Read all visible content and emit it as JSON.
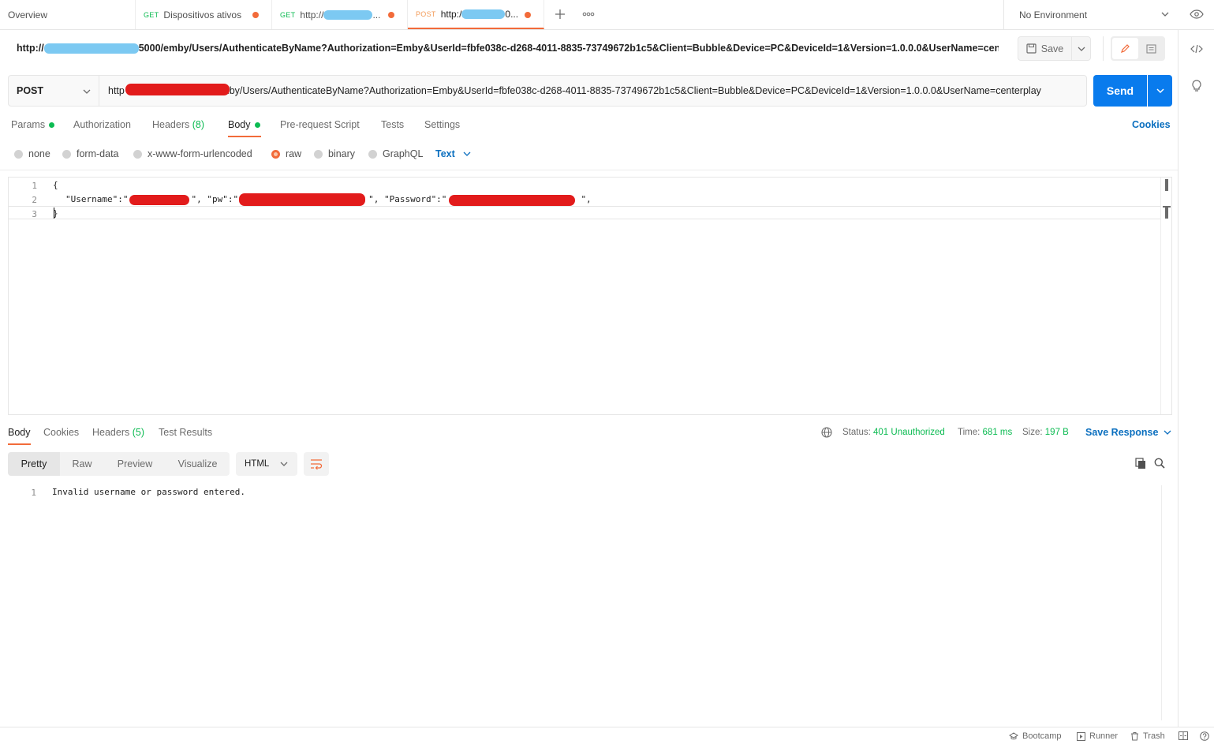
{
  "tabs": [
    {
      "label": "Overview"
    },
    {
      "method": "GET",
      "label": "Dispositivos ativos"
    },
    {
      "method": "GET",
      "label": "http://"
    },
    {
      "method": "POST",
      "label": "http:/",
      "suffix": "0..."
    }
  ],
  "environment": {
    "label": "No Environment"
  },
  "header": {
    "url_prefix": "http://",
    "url_rest": "5000/emby/Users/AuthenticateByName?Authorization=Emby&UserId=fbfe038c-d268-4011-8835-73749672b1c5&Client=Bubble&Device=PC&DeviceId=1&Version=1.0.0.0&UserName=cent...",
    "save_label": "Save"
  },
  "request": {
    "method": "POST",
    "url_prefix": "http",
    "url_rest": "/emby/Users/AuthenticateByName?Authorization=Emby&UserId=fbfe038c-d268-4011-8835-73749672b1c5&Client=Bubble&Device=PC&DeviceId=1&Version=1.0.0.0&UserName=centerplay",
    "send_label": "Send"
  },
  "request_tabs": {
    "params": "Params",
    "authorization": "Authorization",
    "headers": "Headers",
    "headers_count": "(8)",
    "body": "Body",
    "prerequest": "Pre-request Script",
    "tests": "Tests",
    "settings": "Settings",
    "cookies": "Cookies"
  },
  "body_types": {
    "none": "none",
    "form_data": "form-data",
    "urlencoded": "x-www-form-urlencoded",
    "raw": "raw",
    "binary": "binary",
    "graphql": "GraphQL",
    "text": "Text"
  },
  "editor": {
    "line_numbers": [
      "1",
      "2",
      "3"
    ],
    "line1": "{",
    "line3": "}",
    "username_key": "\"Username\":\"",
    "pw_key": "\", \"pw\":\"",
    "password_key": "\", \"Password\":\"",
    "line_end": "\","
  },
  "response_tabs": {
    "body": "Body",
    "cookies": "Cookies",
    "headers": "Headers",
    "headers_count": "(5)",
    "test_results": "Test Results"
  },
  "response_status": {
    "status_label": "Status:",
    "status_value": "401 Unauthorized",
    "time_label": "Time:",
    "time_value": "681 ms",
    "size_label": "Size:",
    "size_value": "197 B",
    "save_response": "Save Response"
  },
  "response_view": {
    "pretty": "Pretty",
    "raw": "Raw",
    "preview": "Preview",
    "visualize": "Visualize",
    "format": "HTML"
  },
  "response_body": {
    "line_number": "1",
    "text": "Invalid username or password entered."
  },
  "footer": {
    "bootcamp": "Bootcamp",
    "runner": "Runner",
    "trash": "Trash"
  },
  "colors": {
    "accent_orange": "#f26b3a",
    "send_blue": "#097bed",
    "status_green": "#0cbb52",
    "link_blue": "#0b6fbf"
  }
}
